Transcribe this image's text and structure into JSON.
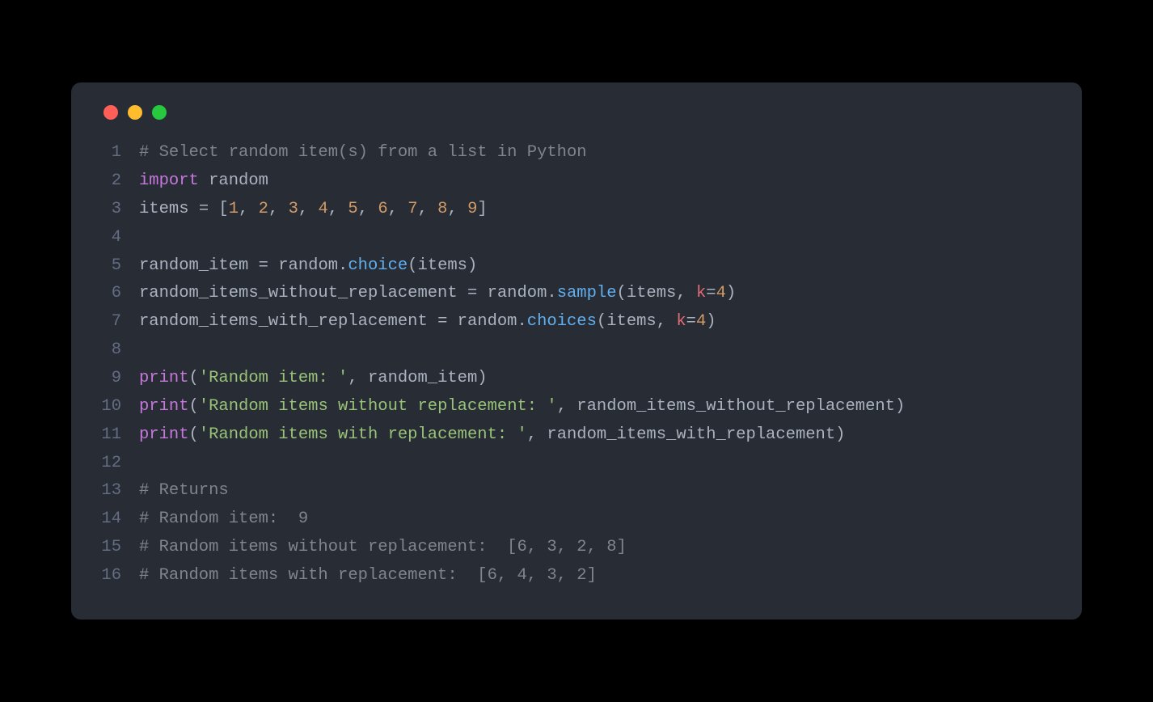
{
  "window": {
    "dots": [
      "red",
      "yellow",
      "green"
    ]
  },
  "code": {
    "lines": [
      {
        "n": "1",
        "tokens": [
          {
            "c": "tk-comment",
            "t": "# Select random item(s) from a list in Python"
          }
        ]
      },
      {
        "n": "2",
        "tokens": [
          {
            "c": "tk-keyword",
            "t": "import"
          },
          {
            "c": "tk-punct",
            "t": " "
          },
          {
            "c": "tk-module",
            "t": "random"
          }
        ]
      },
      {
        "n": "3",
        "tokens": [
          {
            "c": "tk-ident",
            "t": "items "
          },
          {
            "c": "tk-punct",
            "t": "= ["
          },
          {
            "c": "tk-num",
            "t": "1"
          },
          {
            "c": "tk-punct",
            "t": ", "
          },
          {
            "c": "tk-num",
            "t": "2"
          },
          {
            "c": "tk-punct",
            "t": ", "
          },
          {
            "c": "tk-num",
            "t": "3"
          },
          {
            "c": "tk-punct",
            "t": ", "
          },
          {
            "c": "tk-num",
            "t": "4"
          },
          {
            "c": "tk-punct",
            "t": ", "
          },
          {
            "c": "tk-num",
            "t": "5"
          },
          {
            "c": "tk-punct",
            "t": ", "
          },
          {
            "c": "tk-num",
            "t": "6"
          },
          {
            "c": "tk-punct",
            "t": ", "
          },
          {
            "c": "tk-num",
            "t": "7"
          },
          {
            "c": "tk-punct",
            "t": ", "
          },
          {
            "c": "tk-num",
            "t": "8"
          },
          {
            "c": "tk-punct",
            "t": ", "
          },
          {
            "c": "tk-num",
            "t": "9"
          },
          {
            "c": "tk-punct",
            "t": "]"
          }
        ]
      },
      {
        "n": "4",
        "tokens": []
      },
      {
        "n": "5",
        "tokens": [
          {
            "c": "tk-ident",
            "t": "random_item "
          },
          {
            "c": "tk-punct",
            "t": "= "
          },
          {
            "c": "tk-ident",
            "t": "random"
          },
          {
            "c": "tk-punct",
            "t": "."
          },
          {
            "c": "tk-func",
            "t": "choice"
          },
          {
            "c": "tk-punct",
            "t": "(items)"
          }
        ]
      },
      {
        "n": "6",
        "tokens": [
          {
            "c": "tk-ident",
            "t": "random_items_without_replacement "
          },
          {
            "c": "tk-punct",
            "t": "= "
          },
          {
            "c": "tk-ident",
            "t": "random"
          },
          {
            "c": "tk-punct",
            "t": "."
          },
          {
            "c": "tk-func",
            "t": "sample"
          },
          {
            "c": "tk-punct",
            "t": "(items, "
          },
          {
            "c": "tk-param",
            "t": "k"
          },
          {
            "c": "tk-punct",
            "t": "="
          },
          {
            "c": "tk-num",
            "t": "4"
          },
          {
            "c": "tk-punct",
            "t": ")"
          }
        ]
      },
      {
        "n": "7",
        "tokens": [
          {
            "c": "tk-ident",
            "t": "random_items_with_replacement "
          },
          {
            "c": "tk-punct",
            "t": "= "
          },
          {
            "c": "tk-ident",
            "t": "random"
          },
          {
            "c": "tk-punct",
            "t": "."
          },
          {
            "c": "tk-func",
            "t": "choices"
          },
          {
            "c": "tk-punct",
            "t": "(items, "
          },
          {
            "c": "tk-param",
            "t": "k"
          },
          {
            "c": "tk-punct",
            "t": "="
          },
          {
            "c": "tk-num",
            "t": "4"
          },
          {
            "c": "tk-punct",
            "t": ")"
          }
        ]
      },
      {
        "n": "8",
        "tokens": []
      },
      {
        "n": "9",
        "tokens": [
          {
            "c": "tk-builtin",
            "t": "print"
          },
          {
            "c": "tk-punct",
            "t": "("
          },
          {
            "c": "tk-str",
            "t": "'Random item: '"
          },
          {
            "c": "tk-punct",
            "t": ", random_item)"
          }
        ]
      },
      {
        "n": "10",
        "tokens": [
          {
            "c": "tk-builtin",
            "t": "print"
          },
          {
            "c": "tk-punct",
            "t": "("
          },
          {
            "c": "tk-str",
            "t": "'Random items without replacement: '"
          },
          {
            "c": "tk-punct",
            "t": ", random_items_without_replacement)"
          }
        ]
      },
      {
        "n": "11",
        "tokens": [
          {
            "c": "tk-builtin",
            "t": "print"
          },
          {
            "c": "tk-punct",
            "t": "("
          },
          {
            "c": "tk-str",
            "t": "'Random items with replacement: '"
          },
          {
            "c": "tk-punct",
            "t": ", random_items_with_replacement)"
          }
        ]
      },
      {
        "n": "12",
        "tokens": []
      },
      {
        "n": "13",
        "tokens": [
          {
            "c": "tk-comment",
            "t": "# Returns"
          }
        ]
      },
      {
        "n": "14",
        "tokens": [
          {
            "c": "tk-comment",
            "t": "# Random item:  9"
          }
        ]
      },
      {
        "n": "15",
        "tokens": [
          {
            "c": "tk-comment",
            "t": "# Random items without replacement:  [6, 3, 2, 8]"
          }
        ]
      },
      {
        "n": "16",
        "tokens": [
          {
            "c": "tk-comment",
            "t": "# Random items with replacement:  [6, 4, 3, 2]"
          }
        ]
      }
    ]
  }
}
